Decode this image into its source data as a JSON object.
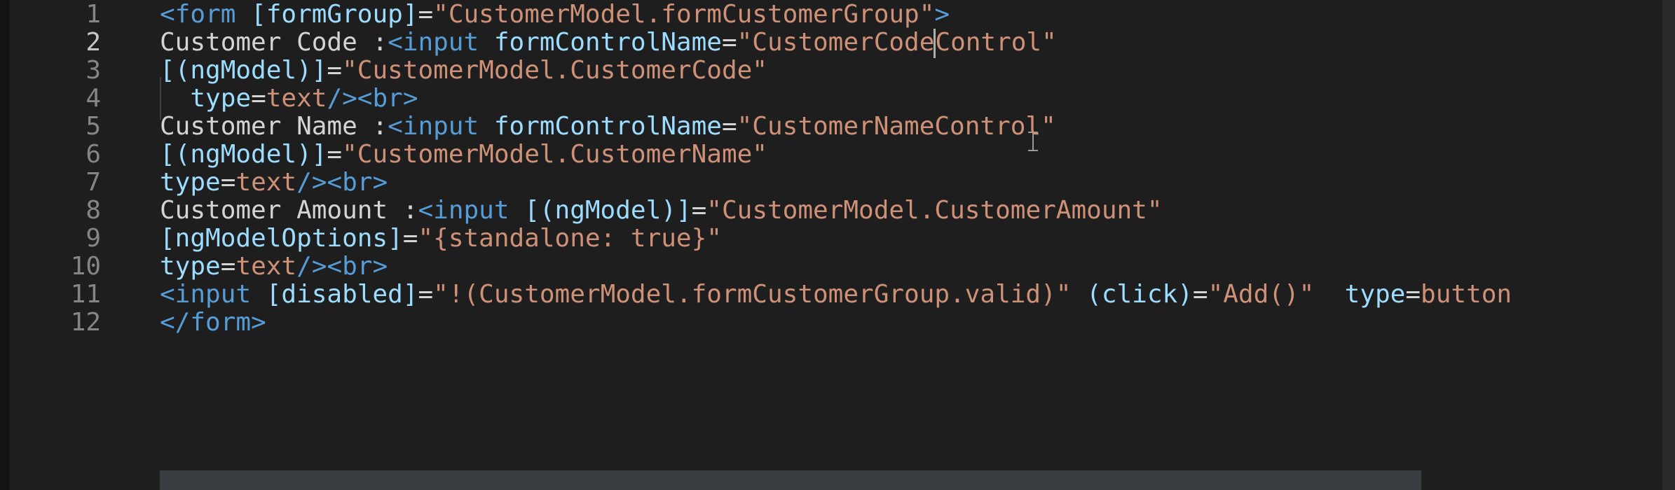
{
  "editor": {
    "lines": [
      {
        "number": "1",
        "tokens": [
          {
            "t": "tag",
            "v": "<form "
          },
          {
            "t": "attr",
            "v": "[formGroup]"
          },
          {
            "t": "text",
            "v": "="
          },
          {
            "t": "str",
            "v": "\"CustomerModel.formCustomerGroup\""
          },
          {
            "t": "tag",
            "v": ">"
          }
        ]
      },
      {
        "number": "2",
        "tokens": [
          {
            "t": "text",
            "v": "Customer Code :"
          },
          {
            "t": "tag",
            "v": "<input "
          },
          {
            "t": "attr",
            "v": "formControlName"
          },
          {
            "t": "text",
            "v": "="
          },
          {
            "t": "str",
            "v": "\"CustomerCode"
          },
          {
            "t": "caret",
            "v": ""
          },
          {
            "t": "str",
            "v": "Control\""
          }
        ]
      },
      {
        "number": "3",
        "tokens": [
          {
            "t": "attr",
            "v": "[(ngModel)]"
          },
          {
            "t": "text",
            "v": "="
          },
          {
            "t": "str",
            "v": "\"CustomerModel.CustomerCode\""
          }
        ]
      },
      {
        "number": "4",
        "tokens": [
          {
            "t": "text",
            "v": "  "
          },
          {
            "t": "attr",
            "v": "type"
          },
          {
            "t": "text",
            "v": "="
          },
          {
            "t": "str",
            "v": "text"
          },
          {
            "t": "tag",
            "v": "/><br>"
          }
        ]
      },
      {
        "number": "5",
        "tokens": [
          {
            "t": "text",
            "v": "Customer Name :"
          },
          {
            "t": "tag",
            "v": "<input "
          },
          {
            "t": "attr",
            "v": "formControlName"
          },
          {
            "t": "text",
            "v": "="
          },
          {
            "t": "str",
            "v": "\"CustomerNameControl\""
          }
        ]
      },
      {
        "number": "6",
        "tokens": [
          {
            "t": "attr",
            "v": "[(ngModel)]"
          },
          {
            "t": "text",
            "v": "="
          },
          {
            "t": "str",
            "v": "\"CustomerModel.CustomerName\""
          }
        ]
      },
      {
        "number": "7",
        "tokens": [
          {
            "t": "attr",
            "v": "type"
          },
          {
            "t": "text",
            "v": "="
          },
          {
            "t": "str",
            "v": "text"
          },
          {
            "t": "tag",
            "v": "/><br>"
          }
        ]
      },
      {
        "number": "8",
        "tokens": [
          {
            "t": "text",
            "v": "Customer Amount :"
          },
          {
            "t": "tag",
            "v": "<input "
          },
          {
            "t": "attr",
            "v": "[(ngModel)]"
          },
          {
            "t": "text",
            "v": "="
          },
          {
            "t": "str",
            "v": "\"CustomerModel.CustomerAmount\""
          }
        ]
      },
      {
        "number": "9",
        "tokens": [
          {
            "t": "attr",
            "v": "[ngModelOptions]"
          },
          {
            "t": "text",
            "v": "="
          },
          {
            "t": "str",
            "v": "\"{standalone: true}\""
          }
        ]
      },
      {
        "number": "10",
        "tokens": [
          {
            "t": "attr",
            "v": "type"
          },
          {
            "t": "text",
            "v": "="
          },
          {
            "t": "str",
            "v": "text"
          },
          {
            "t": "tag",
            "v": "/><br>"
          }
        ]
      },
      {
        "number": "11",
        "tokens": [
          {
            "t": "tag",
            "v": "<input "
          },
          {
            "t": "attr",
            "v": "[disabled]"
          },
          {
            "t": "text",
            "v": "="
          },
          {
            "t": "str",
            "v": "\"!(CustomerModel.formCustomerGroup.valid)\""
          },
          {
            "t": "text",
            "v": " "
          },
          {
            "t": "attr",
            "v": "(click)"
          },
          {
            "t": "text",
            "v": "="
          },
          {
            "t": "str",
            "v": "\"Add()\""
          },
          {
            "t": "text",
            "v": "  "
          },
          {
            "t": "attr",
            "v": "type"
          },
          {
            "t": "text",
            "v": "="
          },
          {
            "t": "str",
            "v": "button"
          }
        ]
      },
      {
        "number": "12",
        "tokens": [
          {
            "t": "tag",
            "v": "</form>"
          }
        ]
      }
    ],
    "active_line": "2",
    "colors": {
      "background": "#1e1e1e",
      "tag": "#569cd6",
      "attribute": "#9cdcfe",
      "string": "#ce9178",
      "text": "#d4d4d4",
      "line_number": "#858585",
      "active_line_number": "#c6c6c6"
    }
  }
}
